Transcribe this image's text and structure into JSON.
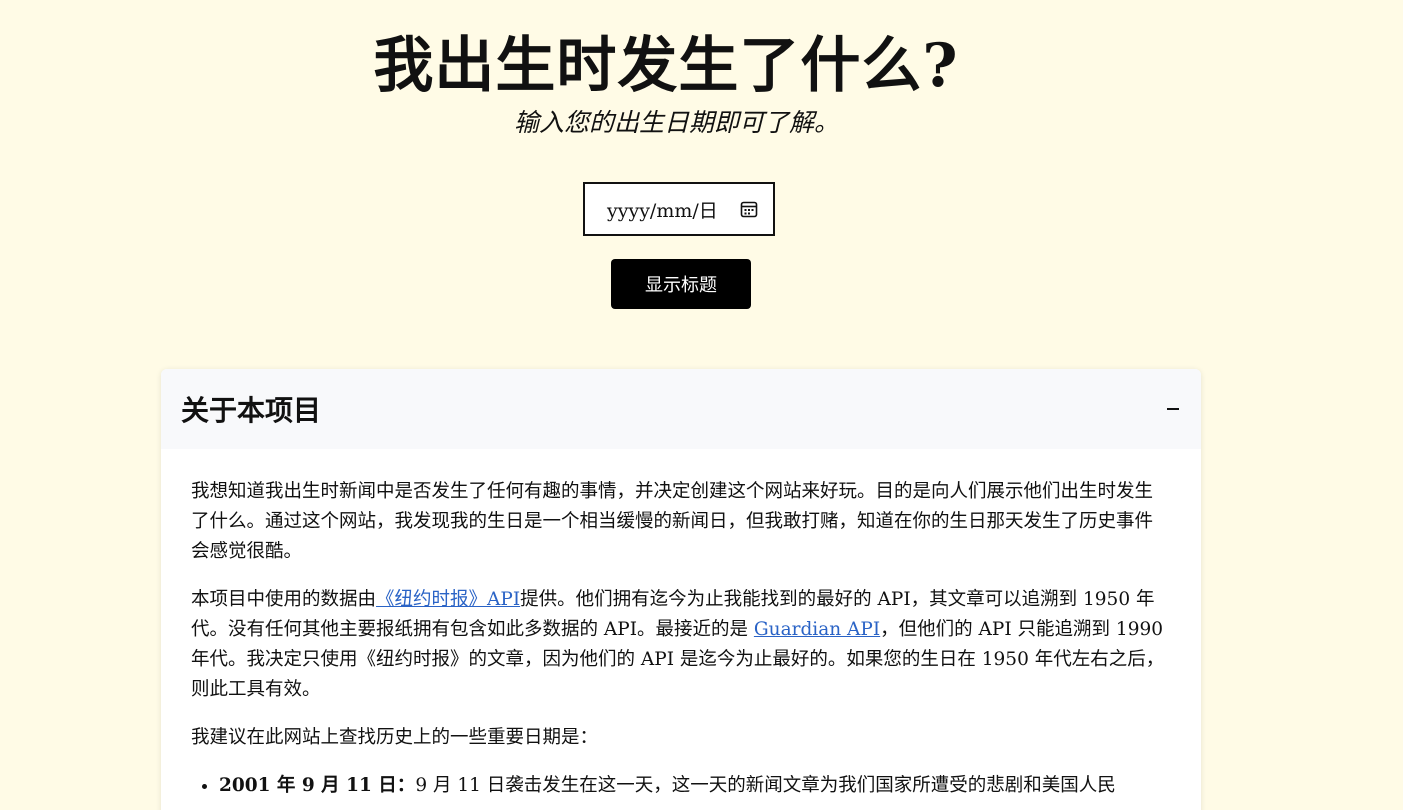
{
  "header": {
    "title": "我出生时发生了什么?",
    "subtitle": "输入您的出生日期即可了解。"
  },
  "form": {
    "date_placeholder": "yyyy/mm/日",
    "submit_label": "显示标题"
  },
  "icons": {
    "calendar": "calendar-icon",
    "collapse": "minus-icon"
  },
  "about": {
    "title": "关于本项目",
    "p1": "我想知道我出生时新闻中是否发生了任何有趣的事情，并决定创建这个网站来好玩。目的是向人们展示他们出生时发生了什么。通过这个网站，我发现我的生日是一个相当缓慢的新闻日，但我敢打赌，知道在你的生日那天发生了历史事件会感觉很酷。",
    "p2_before": "本项目中使用的数据由",
    "p2_link1": "《纽约时报》API",
    "p2_middle": "提供。他们拥有迄今为止我能找到的最好的 API，其文章可以追溯到 1950 年代。没有任何其他主要报纸拥有包含如此多数据的 API。最接近的是 ",
    "p2_link2": "Guardian API",
    "p2_after": "，但他们的 API 只能追溯到 1990 年代。我决定只使用《纽约时报》的文章，因为他们的 API 是迄今为止最好的。如果您的生日在 1950 年代左右之后，则此工具有效。",
    "p3": "我建议在此网站上查找历史上的一些重要日期是：",
    "list": [
      {
        "date": "2001 年 9 月 11 日：",
        "text": "9 月 11 日袭击发生在这一天，这一天的新闻文章为我们国家所遭受的悲剧和美国人民"
      }
    ]
  },
  "colors": {
    "background": "#fffbe6",
    "button": "#000000",
    "link": "#2a63c6",
    "card_header": "#f8f9fb"
  }
}
